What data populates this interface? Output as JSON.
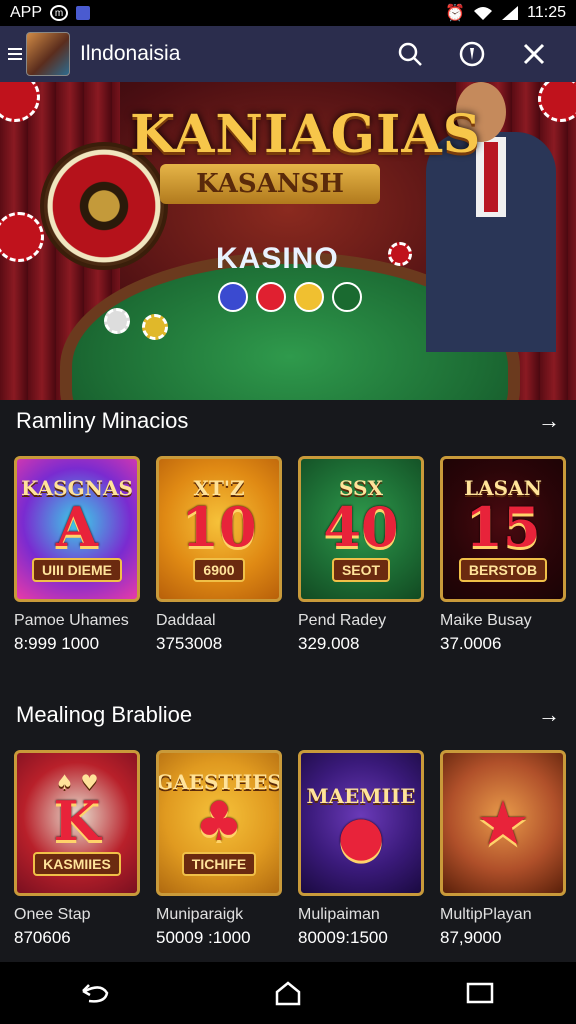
{
  "status_bar": {
    "left_label": "APP",
    "time": "11:25"
  },
  "header": {
    "title": "Ilndonaisia"
  },
  "hero": {
    "title": "KANIAGIAS",
    "ribbon": "KASANSH",
    "table_label": "KASINO"
  },
  "sections": [
    {
      "title": "Ramliny Minacios",
      "cards": [
        {
          "top": "KASGNAS",
          "big": "A",
          "bottom": "UIII DIEME",
          "name": "Pamoe Uhames",
          "value": "8:999 1000",
          "colors": [
            "#3bd0e8",
            "#7a2bd0",
            "#e83ba8"
          ]
        },
        {
          "top": "XT'Z",
          "big": "10",
          "bottom": "6900",
          "name": "Daddaal",
          "value": "3753008",
          "colors": [
            "#f6c23a",
            "#e08a14",
            "#b8600a"
          ]
        },
        {
          "top": "SSX",
          "big": "40",
          "bottom": "SEOT",
          "name": "Pend Radey",
          "value": "329.008",
          "colors": [
            "#2f9a4c",
            "#1d6e35",
            "#124a22"
          ]
        },
        {
          "top": "LASAN",
          "big": "15",
          "bottom": "BERSTOB",
          "name": "Maike Busay",
          "value": "37.0006",
          "colors": [
            "#4a0a10",
            "#2a0508",
            "#1a0305"
          ]
        }
      ]
    },
    {
      "title": "Mealinog Brablioe",
      "cards": [
        {
          "top": "♠ ♥",
          "big": "K",
          "bottom": "KASMIIES",
          "name": "Onee Stap",
          "value": "870606",
          "colors": [
            "#e8e0d0",
            "#b8202a",
            "#7a1020"
          ]
        },
        {
          "top": "GAESTHES",
          "big": "♣",
          "bottom": "TICHIFE",
          "name": "Muniparaigk",
          "value": "50009 :1000",
          "colors": [
            "#f6c23a",
            "#e09a20",
            "#b06a10"
          ]
        },
        {
          "top": "MAEMIIE",
          "big": "●",
          "bottom": "",
          "name": "Mulipaiman",
          "value": "80009:1500",
          "colors": [
            "#6a3ab8",
            "#3a1a7a",
            "#1a0a40"
          ]
        },
        {
          "top": "",
          "big": "★",
          "bottom": "",
          "name": "MultipPlayan",
          "value": "87,9000",
          "colors": [
            "#e89a4a",
            "#b0502a",
            "#5a200a"
          ]
        }
      ]
    }
  ],
  "colors": {
    "header_bg": "#2b2d4d",
    "page_bg": "#17181c",
    "gold": "#f7c64a"
  }
}
